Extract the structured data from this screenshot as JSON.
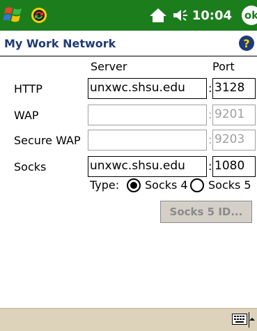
{
  "status_bar": {
    "time": "10:04",
    "ok_label": "ok",
    "icons": [
      "windows-start-icon",
      "activesync-icon",
      "home-network-icon",
      "speaker-icon"
    ]
  },
  "title": {
    "text": "My Work Network",
    "help_label": "?"
  },
  "columns": {
    "server": "Server",
    "port": "Port"
  },
  "rows": [
    {
      "label": "HTTP",
      "server": "unxwc.shsu.edu",
      "port": "3128",
      "enabled": true
    },
    {
      "label": "WAP",
      "server": "",
      "port": "9201",
      "enabled": false
    },
    {
      "label": "Secure WAP",
      "server": "",
      "port": "9203",
      "enabled": false
    },
    {
      "label": "Socks",
      "server": "unxwc.shsu.edu",
      "port": "1080",
      "enabled": true
    }
  ],
  "separator": ":",
  "type": {
    "label": "Type:",
    "options": [
      "Socks 4",
      "Socks 5"
    ],
    "selected": "Socks 4"
  },
  "socks5_button": "Socks 5 ID...",
  "colors": {
    "title_bar_green": "#1c7d1c",
    "title_text": "#1f3a7a",
    "disabled_gray": "#a0a0a0",
    "bottom_bar": "#ddd3bb"
  }
}
